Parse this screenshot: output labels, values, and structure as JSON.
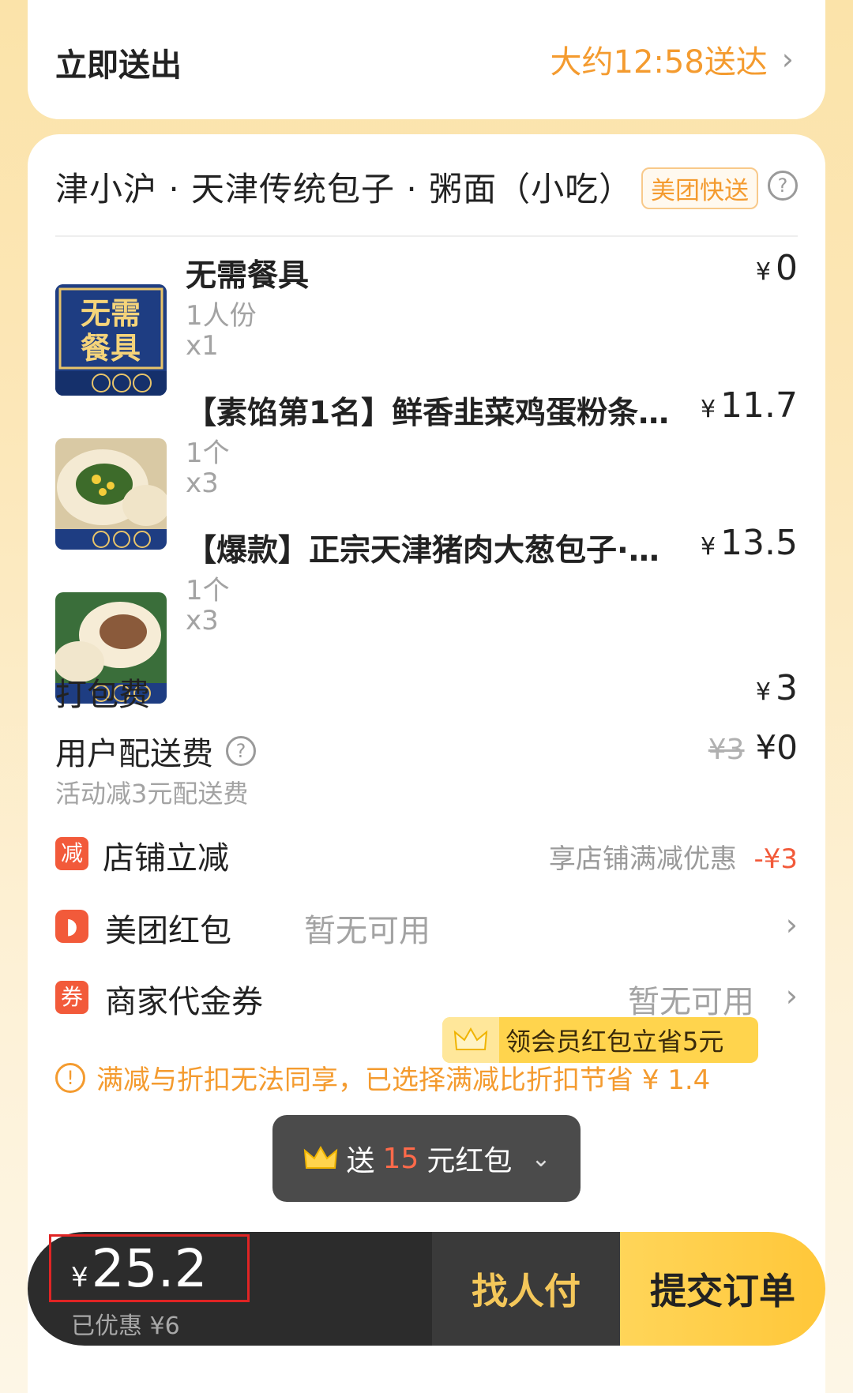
{
  "delivery": {
    "label": "立即送出",
    "eta": "大约12:58送达"
  },
  "shop": {
    "name": "津小沪 · 天津传统包子 · 粥面（小吃）",
    "badge": "美团快送",
    "help_icon": "question-circle-icon"
  },
  "items": [
    {
      "title": "无需餐具",
      "spec": "1人份",
      "qty": "x1",
      "price": "0",
      "thumb_text_1": "无需",
      "thumb_text_2": "餐具"
    },
    {
      "title": "【素馅第1名】鲜香韭菜鸡蛋粉条…",
      "spec": "1个",
      "qty": "x3",
      "price": "11.7"
    },
    {
      "title": "【爆款】正宗天津猪肉大葱包子·…",
      "spec": "1个",
      "qty": "x3",
      "price": "13.5"
    }
  ],
  "currency": "¥",
  "packing": {
    "label": "打包费",
    "price": "3"
  },
  "delivery_fee": {
    "label": "用户配送费",
    "original": "¥3",
    "price": "¥0",
    "note": "活动减3元配送费"
  },
  "store_discount": {
    "icon_text": "减",
    "label": "店铺立减",
    "desc": "享店铺满减优惠",
    "amount": "-¥3"
  },
  "red_packet": {
    "label": "美团红包",
    "status": "暂无可用",
    "vip_text": "领会员红包立省5元"
  },
  "coupon": {
    "icon_text": "券",
    "label": "商家代金券",
    "status": "暂无可用"
  },
  "warning": "满减与折扣无法同享，已选择满减比折扣节省 ¥ 1.4",
  "popup": {
    "prefix": "送",
    "amount": "15",
    "suffix": "元红包"
  },
  "checkout": {
    "total": "25.2",
    "saved": "已优惠 ¥6",
    "pay_for_me": "找人付",
    "submit": "提交订单"
  },
  "colors": {
    "accent_orange": "#f49b2f",
    "discount_red": "#f25a3a",
    "submit_yellow": "#ffcb3d",
    "bar_dark": "#2c2c2c"
  }
}
